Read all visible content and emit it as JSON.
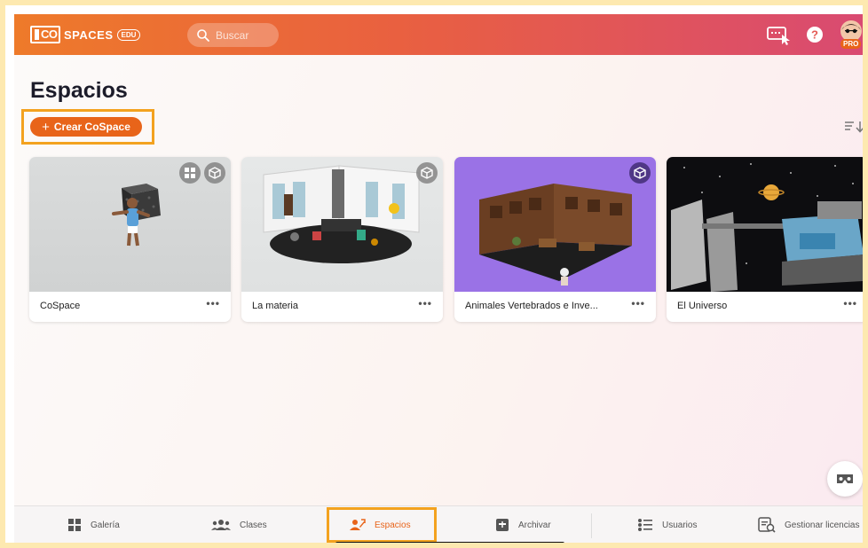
{
  "brand": {
    "logo_letters": "CO",
    "name": "SPACES",
    "edition": "EDU"
  },
  "search": {
    "placeholder": "Buscar"
  },
  "header": {
    "pro_badge": "PRO"
  },
  "page": {
    "title": "Espacios",
    "create_button": "Crear CoSpace",
    "create_icon": "+"
  },
  "cards": [
    {
      "title": "CoSpace",
      "more": "•••",
      "thumb": "character-cube-scene"
    },
    {
      "title": "La materia",
      "more": "•••",
      "thumb": "library-room-scene"
    },
    {
      "title": "Animales Vertebrados e Inve...",
      "more": "•••",
      "thumb": "museum-room-scene"
    },
    {
      "title": "El Universo",
      "more": "•••",
      "thumb": "space-station-scene"
    }
  ],
  "bottom_nav": [
    {
      "label": "Galería",
      "icon": "grid-icon",
      "active": false
    },
    {
      "label": "Clases",
      "icon": "people-icon",
      "active": false
    },
    {
      "label": "Espacios",
      "icon": "spaces-icon",
      "active": true
    },
    {
      "label": "Archivar",
      "icon": "archive-icon",
      "active": false
    },
    {
      "label": "Usuarios",
      "icon": "users-list-icon",
      "active": false
    },
    {
      "label": "Gestionar licencias",
      "icon": "license-icon",
      "active": false
    }
  ],
  "colors": {
    "accent": "#e8641a",
    "highlight": "#f3a21f",
    "header_start": "#ee7a2a",
    "header_end": "#d94a72"
  }
}
